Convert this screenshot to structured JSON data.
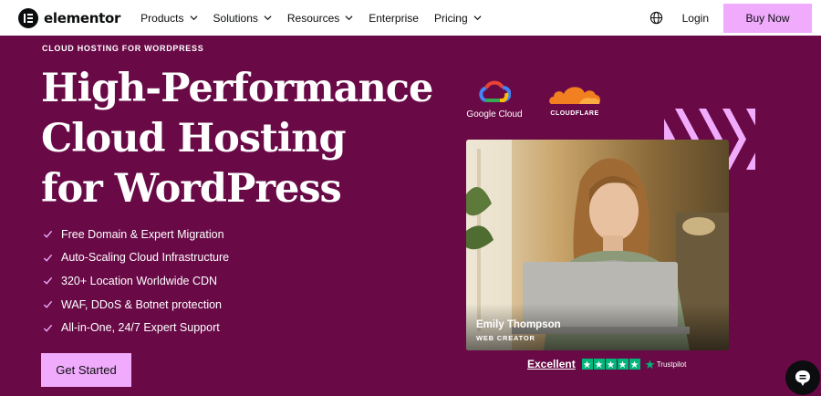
{
  "brand": {
    "name": "elementor"
  },
  "nav": {
    "items": [
      {
        "label": "Products",
        "has_dropdown": true
      },
      {
        "label": "Solutions",
        "has_dropdown": true
      },
      {
        "label": "Resources",
        "has_dropdown": true
      },
      {
        "label": "Enterprise",
        "has_dropdown": false
      },
      {
        "label": "Pricing",
        "has_dropdown": true
      }
    ],
    "globe_icon": "globe-icon",
    "login_label": "Login",
    "buy_label": "Buy Now"
  },
  "hero": {
    "eyebrow": "CLOUD HOSTING FOR WORDPRESS",
    "headline_lines": [
      "High-Performance",
      "Cloud Hosting",
      "for WordPress"
    ],
    "features": [
      "Free Domain & Expert Migration",
      "Auto-Scaling Cloud Infrastructure",
      "320+ Location Worldwide CDN",
      "WAF, DDoS & Botnet protection",
      "All-in-One, 24/7 Expert Support"
    ],
    "cta_label": "Get Started"
  },
  "partners": {
    "google": "Google Cloud",
    "cloudflare": "CLOUDFLARE"
  },
  "testimonial": {
    "name": "Emily Thompson",
    "role": "WEB CREATOR"
  },
  "trustpilot": {
    "rating_label": "Excellent",
    "stars": 5,
    "brand": "Trustpilot"
  },
  "colors": {
    "background": "#690a47",
    "accent": "#f0abfc",
    "trustpilot_green": "#00b67a"
  }
}
